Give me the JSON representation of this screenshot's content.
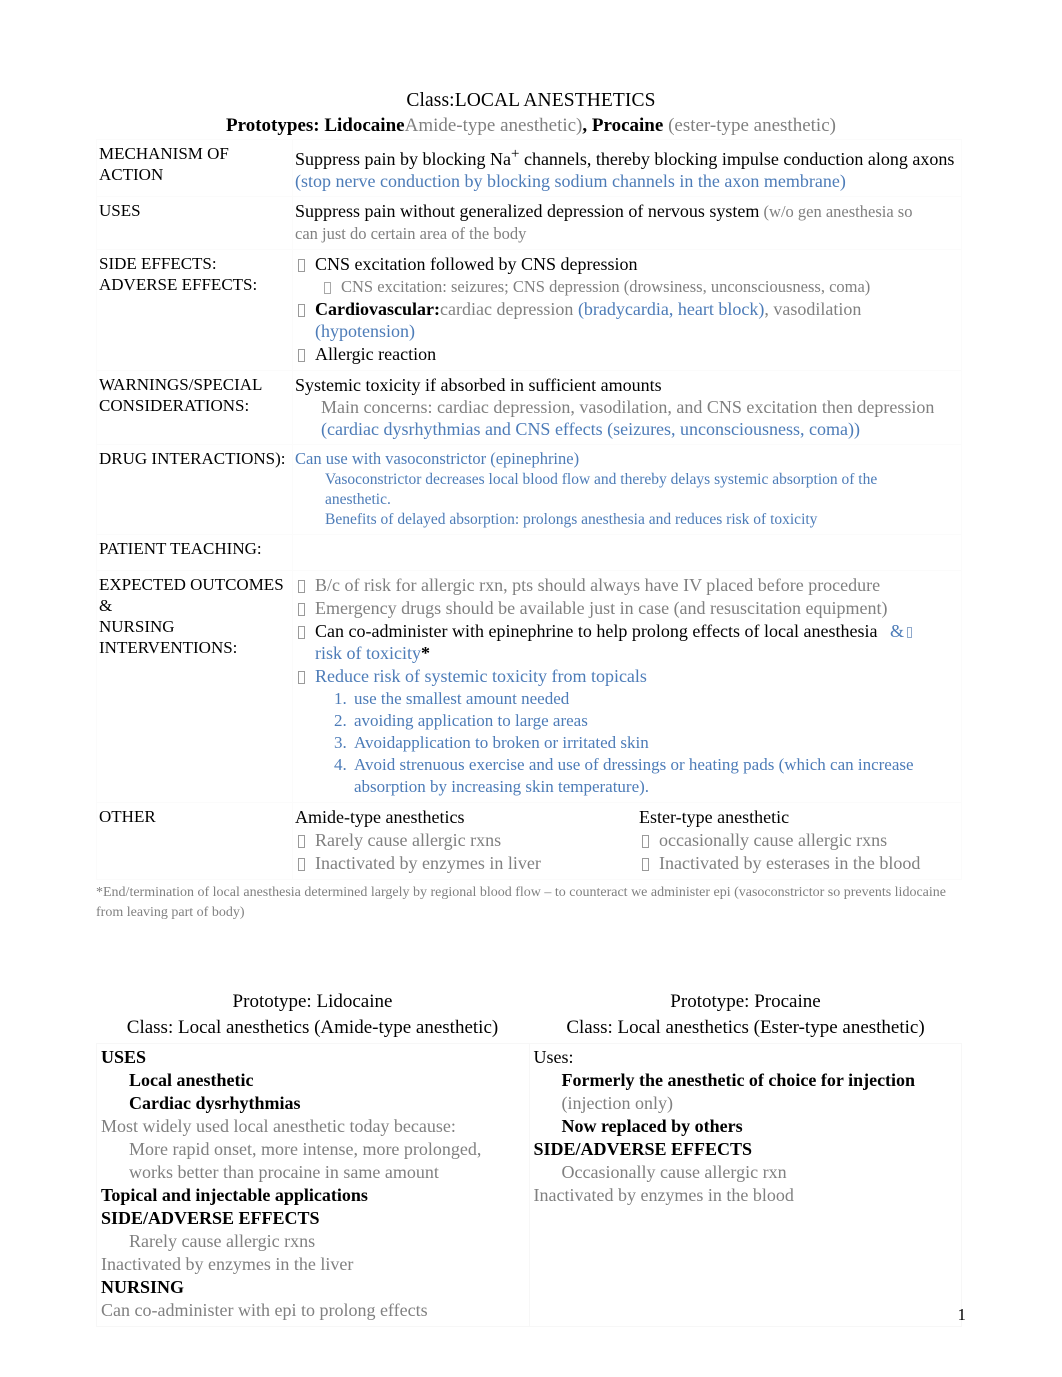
{
  "colors": {
    "blue": "#4d7cb8",
    "gray": "#808080",
    "black": "#000000"
  },
  "header": {
    "class_title_prefix": "Class:",
    "class_title": "LOCAL ANESTHETICS",
    "prototypes_label": "Prototypes:",
    "prototype_1": "Lidocaine",
    "prototype_1_type": "Amide-type anesthetic)",
    "separator": ", ",
    "prototype_2": "Procaine",
    "prototype_2_type": "(ester-type anesthetic)"
  },
  "table": {
    "rows": [
      {
        "label": "MECHANISM OF ACTION",
        "lines": [
          {
            "text_black_pre": "Suppress pain by blocking Na",
            "sup": "+",
            "text_black_post": " channels, thereby blocking impulse conduction along axons"
          },
          {
            "text_blue": "(stop nerve conduction by blocking sodium channels in the axon membrane)"
          }
        ]
      },
      {
        "label": "USES",
        "lines": [
          {
            "text_black": "Suppress pain without generalized depression of nervous system",
            "text_gray": "  (w/o gen anesthesia so"
          },
          {
            "text_gray_full": "can just do certain area of the body"
          }
        ]
      },
      {
        "label_line1": "SIDE EFFECTS:",
        "label_line2": "ADVERSE EFFECTS:",
        "bullets": [
          {
            "text": "CNS excitation followed by CNS depression",
            "color": "black"
          },
          {
            "sub": "CNS excitation: seizures; CNS depression (drowsiness, unconsciousness, coma)",
            "color": "gray"
          },
          {
            "bold": "Cardiovascular:",
            "gray1": "cardiac depression",
            "blue1": " (bradycardia, heart block)",
            "gray2": ", vasodilation",
            "blue2": "(hypotension)"
          },
          {
            "text": "Allergic reaction",
            "color": "black"
          }
        ]
      },
      {
        "label_line1": "WARNINGS/SPECIAL",
        "label_line2": "CONSIDERATIONS:",
        "lines": [
          {
            "text_black_full": "Systemic toxicity if absorbed in sufficient amounts"
          },
          {
            "indent_gray": "Main concerns: cardiac depression, vasodilation, and CNS excitation then depression"
          },
          {
            "indent_blue": "(cardiac dysrhythmias and CNS effects (seizures, unconsciousness, coma))"
          }
        ]
      },
      {
        "label": "DRUG INTERACTIONS):",
        "lines": [
          {
            "blue_full": "Can use with vasoconstrictor (epinephrine)"
          },
          {
            "indent_blue_sm": "Vasoconstrictor decreases local blood flow and thereby delays systemic absorption of the"
          },
          {
            "indent_blue_sm": "anesthetic."
          },
          {
            "indent_blue_sm": "Benefits of delayed absorption:  prolongs anesthesia  and reduces risk of toxicity"
          }
        ]
      },
      {
        "label": "PATIENT TEACHING:",
        "lines": []
      },
      {
        "label_line1": "EXPECTED OUTCOMES &",
        "label_line2": "NURSING INTERVENTIONS:",
        "bullets": [
          {
            "text": "B/c of risk for allergic rxn, pts should always have IV placed before procedure",
            "color": "gray"
          },
          {
            "text": "Emergency drugs should be available just in case (and resuscitation equipment)",
            "color": "gray"
          },
          {
            "text": "Can co-administer with epinephrine to help prolong effects of local anesthesia",
            "color": "black",
            "blue_amp": "&",
            "blue_tail": "risk of toxicity",
            "star": "*"
          },
          {
            "text": "Reduce risk of systemic toxicity from topicals",
            "color": "blue"
          }
        ],
        "numbered": [
          "use the smallest amount needed",
          "avoiding application to large areas",
          "Avoidapplication to broken or irritated skin",
          "Avoid strenuous exercise and use of dressings or heating pads (which can increase absorption by increasing skin temperature)."
        ]
      },
      {
        "label": "OTHER",
        "other": {
          "left_heading": "Amide-type anesthetics",
          "left_items": [
            "Rarely cause allergic rxns",
            "Inactivated by enzymes in liver"
          ],
          "right_heading": "Ester-type anesthetic",
          "right_items": [
            "occasionally cause allergic rxns",
            "Inactivated by esterases in the blood"
          ]
        }
      }
    ]
  },
  "footnote": "*End/termination of local anesthesia determined largely by regional blood flow – to counteract we administer epi (vasoconstrictor so prevents lidocaine from leaving part of body)",
  "prototype_cards": {
    "left": {
      "heading_1": "Prototype: Lidocaine",
      "heading_2": "Class: Local anesthetics (Amide-type anesthetic)",
      "lines": [
        {
          "t": "USES",
          "style": "head"
        },
        {
          "t": "Local anesthetic",
          "style": "indent-bold"
        },
        {
          "t": "Cardiac dysrhythmias",
          "style": "indent-bold"
        },
        {
          "t": "Most widely used local anesthetic today because:",
          "style": "gray"
        },
        {
          "t": "More rapid onset, more intense, more prolonged,",
          "style": "indent-gray"
        },
        {
          "t": "works better than procaine in same amount",
          "style": "indent-gray"
        },
        {
          "t": "Topical and injectable applications",
          "style": "bold"
        },
        {
          "t": "SIDE/ADVERSE EFFECTS",
          "style": "head"
        },
        {
          "t": "Rarely cause allergic rxns",
          "style": "indent-gray"
        },
        {
          "t": "Inactivated by enzymes in the liver",
          "style": "gray"
        },
        {
          "t": "NURSING",
          "style": "head"
        },
        {
          "t": "Can co-administer with epi to prolong effects",
          "style": "gray"
        }
      ]
    },
    "right": {
      "heading_1": "Prototype: Procaine",
      "heading_2": "Class: Local anesthetics (Ester-type anesthetic)",
      "lines": [
        {
          "t": "Uses:",
          "style": "plain"
        },
        {
          "t": "Formerly the anesthetic of choice for injection",
          "style": "indent-bold"
        },
        {
          "t": "(injection only)",
          "style": "indent-gray"
        },
        {
          "t": "Now replaced by others",
          "style": "indent-bold"
        },
        {
          "t": "SIDE/ADVERSE EFFECTS",
          "style": "head"
        },
        {
          "t": "Occasionally cause allergic rxn",
          "style": "indent-gray"
        },
        {
          "t": "Inactivated by enzymes in the blood",
          "style": "gray"
        }
      ]
    }
  },
  "page_number": "1"
}
